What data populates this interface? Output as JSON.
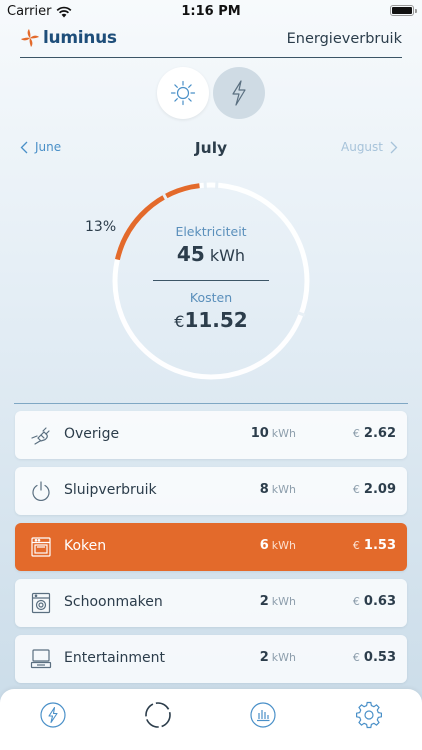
{
  "status": {
    "carrier": "Carrier",
    "time": "1:16 PM"
  },
  "header": {
    "logo_text": "luminus",
    "title": "Energieverbruik"
  },
  "modes": {
    "solar_icon": "sun-icon",
    "electricity_icon": "bolt-icon",
    "selected": "solar"
  },
  "months": {
    "prev": "June",
    "current": "July",
    "next": "August"
  },
  "summary": {
    "percent": "13%",
    "share": 0.13,
    "electricity_label": "Elektriciteit",
    "electricity_value": "45",
    "electricity_unit": "kWh",
    "cost_label": "Kosten",
    "cost_currency": "€",
    "cost_value": "11.52"
  },
  "colors": {
    "accent": "#e36a2b",
    "link": "#4a90c8",
    "text": "#2c3d4b",
    "brand": "#1e4e7a"
  },
  "categories": [
    {
      "name": "Overige",
      "icon": "plug-icon",
      "kwh": "10",
      "kwh_unit": "kWh",
      "currency": "€",
      "cost": "2.62",
      "active": false
    },
    {
      "name": "Sluipverbruik",
      "icon": "power-icon",
      "kwh": "8",
      "kwh_unit": "kWh",
      "currency": "€",
      "cost": "2.09",
      "active": false
    },
    {
      "name": "Koken",
      "icon": "oven-icon",
      "kwh": "6",
      "kwh_unit": "kWh",
      "currency": "€",
      "cost": "1.53",
      "active": true
    },
    {
      "name": "Schoonmaken",
      "icon": "washing-machine-icon",
      "kwh": "2",
      "kwh_unit": "kWh",
      "currency": "€",
      "cost": "0.63",
      "active": false
    },
    {
      "name": "Entertainment",
      "icon": "tv-icon",
      "kwh": "2",
      "kwh_unit": "kWh",
      "currency": "€",
      "cost": "0.53",
      "active": false
    }
  ],
  "tabbar": {
    "items": [
      {
        "icon": "bolt-icon",
        "selected": false
      },
      {
        "icon": "ring-chart-icon",
        "selected": true
      },
      {
        "icon": "bar-chart-icon",
        "selected": false
      },
      {
        "icon": "gear-icon",
        "selected": false
      }
    ]
  }
}
